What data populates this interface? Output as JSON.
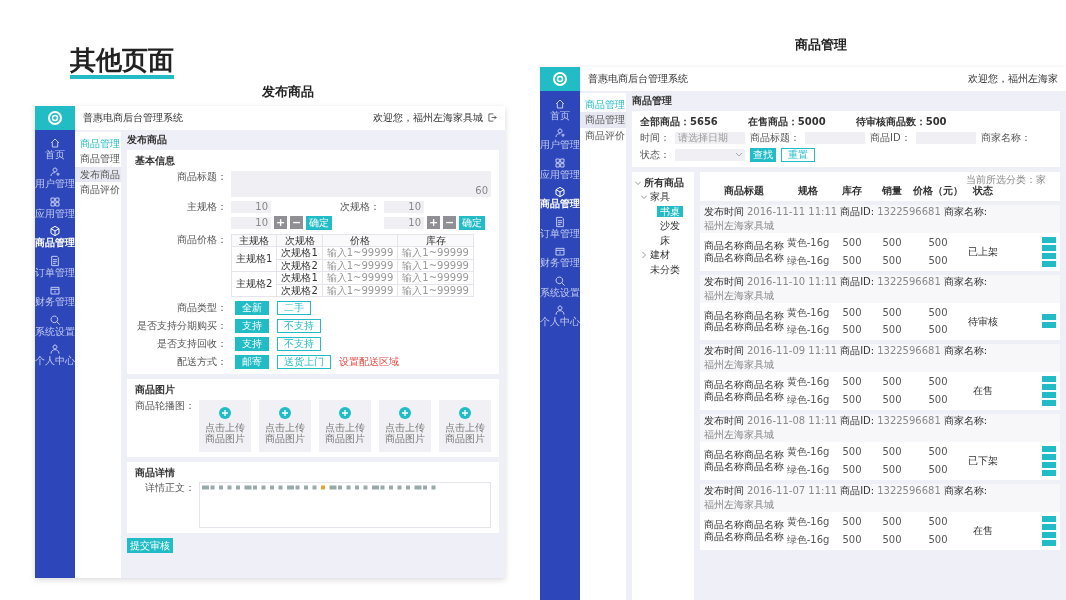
{
  "slide": {
    "title": "其他页面"
  },
  "publish": {
    "caption": "发布商品",
    "app_name": "普惠电商后台管理系统",
    "welcome": "欢迎您，福州左海家具城",
    "nav": [
      {
        "label": "首页",
        "selected": false
      },
      {
        "label": "用户管理",
        "selected": false
      },
      {
        "label": "应用管理",
        "selected": false
      },
      {
        "label": "商品管理",
        "selected": true
      },
      {
        "label": "订单管理",
        "selected": false
      },
      {
        "label": "财务管理",
        "selected": false
      },
      {
        "label": "系统设置",
        "selected": false
      },
      {
        "label": "个人中心",
        "selected": false
      }
    ],
    "subnav": {
      "title": "商品管理",
      "items": [
        {
          "label": "商品管理",
          "selected": false
        },
        {
          "label": "发布商品",
          "selected": true
        },
        {
          "label": "商品评价",
          "selected": false
        }
      ]
    },
    "page_title": "发布商品",
    "basic": {
      "heading": "基本信息",
      "title_label": "商品标题：",
      "title_counter": "60",
      "main_spec": {
        "label": "主规格：",
        "counter": "10",
        "counter2": "10",
        "plus": "+",
        "minus": "−",
        "confirm": "确定"
      },
      "sub_spec": {
        "label": "次规格：",
        "counter": "10",
        "counter2": "10",
        "plus": "+",
        "minus": "−",
        "confirm": "确定"
      },
      "price_label": "商品价格：",
      "price_columns": [
        "主规格",
        "次规格",
        "价格",
        "库存"
      ],
      "price_groups": [
        {
          "main": "主规格1",
          "subs": [
            {
              "name": "次规格1",
              "price": "输入1~99999",
              "stock": "输入1~99999"
            },
            {
              "name": "次规格2",
              "price": "输入1~99999",
              "stock": "输入1~99999"
            }
          ]
        },
        {
          "main": "主规格2",
          "subs": [
            {
              "name": "次规格1",
              "price": "输入1~99999",
              "stock": "输入1~99999"
            },
            {
              "name": "次规格2",
              "price": "输入1~99999",
              "stock": "输入1~99999"
            }
          ]
        }
      ],
      "options": [
        {
          "label": "商品类型：",
          "choices": [
            {
              "label": "全新",
              "selected": true
            },
            {
              "label": "二手",
              "selected": false
            }
          ]
        },
        {
          "label": "是否支持分期购买：",
          "choices": [
            {
              "label": "支持",
              "selected": true
            },
            {
              "label": "不支持",
              "selected": false
            }
          ]
        },
        {
          "label": "是否支持回收：",
          "choices": [
            {
              "label": "支持",
              "selected": true
            },
            {
              "label": "不支持",
              "selected": false
            }
          ]
        },
        {
          "label": "配送方式：",
          "choices": [
            {
              "label": "邮寄",
              "selected": true
            },
            {
              "label": "送货上门",
              "selected": false
            }
          ],
          "link": "设置配送区域"
        }
      ]
    },
    "pictures": {
      "heading": "商品图片",
      "label": "商品轮播图：",
      "tiles": [
        "点击上传商品图片",
        "点击上传商品图片",
        "点击上传商品图片",
        "点击上传商品图片",
        "点击上传商品图片"
      ]
    },
    "details": {
      "heading": "商品详情",
      "label": "详情正文："
    },
    "submit": "提交审核"
  },
  "manage": {
    "caption": "商品管理",
    "app_name": "普惠电商后台管理系统",
    "welcome": "欢迎您，福州左海家",
    "nav": [
      {
        "label": "首页",
        "selected": false
      },
      {
        "label": "用户管理",
        "selected": false
      },
      {
        "label": "应用管理",
        "selected": false
      },
      {
        "label": "商品管理",
        "selected": true
      },
      {
        "label": "订单管理",
        "selected": false
      },
      {
        "label": "财务管理",
        "selected": false
      },
      {
        "label": "系统设置",
        "selected": false
      },
      {
        "label": "个人中心",
        "selected": false
      }
    ],
    "subnav": {
      "title": "商品管理",
      "items": [
        {
          "label": "商品管理",
          "selected": true
        },
        {
          "label": "商品评价",
          "selected": false
        }
      ]
    },
    "page_title": "商品管理",
    "stats": [
      "全部商品：5656",
      "在售商品：5000",
      "待审核商品数：500"
    ],
    "filters": {
      "time_label": "时间：",
      "time_placeholder": "请选择日期",
      "title_label": "商品标题：",
      "id_label": "商品ID：",
      "shop_label": "商家名称：",
      "status_label": "状态：",
      "search": "查找",
      "reset": "重置"
    },
    "tree": [
      {
        "label": "所有商品",
        "expanded": true,
        "children": [
          {
            "label": "家具",
            "expanded": true,
            "children": [
              {
                "label": "书桌",
                "selected": true
              },
              {
                "label": "沙发",
                "selected": false
              },
              {
                "label": "床",
                "selected": false
              }
            ]
          },
          {
            "label": "建材",
            "expanded": false
          },
          {
            "label": "未分类"
          }
        ]
      }
    ],
    "current_category": "当前所选分类：家",
    "columns": [
      "商品标题",
      "规格",
      "库存",
      "销量",
      "价格（元）",
      "状态"
    ],
    "rows": [
      {
        "time_label": "发布时间",
        "time": "2016-11-11 11:11",
        "id_label": "商品ID:",
        "id": "1322596681",
        "shop_label": "商家名称:",
        "shop": "福州左海家具城",
        "name": "商品名称商品名称商品名称商品名称",
        "specs": [
          {
            "spec": "黄色-16g",
            "stock": "500",
            "sales": "500",
            "price": "500"
          },
          {
            "spec": "绿色-16g",
            "stock": "500",
            "sales": "500",
            "price": "500"
          }
        ],
        "status": "已上架",
        "actions": [
          {
            "kind": "button"
          },
          {
            "kind": "button"
          },
          {
            "kind": "button"
          },
          {
            "kind": "button"
          }
        ]
      },
      {
        "time_label": "发布时间",
        "time": "2016-11-10 11:11",
        "id_label": "商品ID:",
        "id": "1322596681",
        "shop_label": "商家名称:",
        "shop": "福州左海家具城",
        "name": "商品名称商品名称商品名称商品名称",
        "specs": [
          {
            "spec": "黄色-16g",
            "stock": "500",
            "sales": "500",
            "price": "500"
          },
          {
            "spec": "绿色-16g",
            "stock": "500",
            "sales": "500",
            "price": "500"
          }
        ],
        "status": "待审核",
        "actions": [
          {
            "kind": "button"
          },
          {
            "kind": "button"
          }
        ]
      },
      {
        "time_label": "发布时间",
        "time": "2016-11-09 11:11",
        "id_label": "商品ID:",
        "id": "1322596681",
        "shop_label": "商家名称:",
        "shop": "福州左海家具城",
        "name": "商品名称商品名称商品名称商品名称",
        "specs": [
          {
            "spec": "黄色-16g",
            "stock": "500",
            "sales": "500",
            "price": "500"
          },
          {
            "spec": "绿色-16g",
            "stock": "500",
            "sales": "500",
            "price": "500"
          }
        ],
        "status": "在售",
        "actions": [
          {
            "kind": "button"
          },
          {
            "kind": "button"
          },
          {
            "kind": "button"
          },
          {
            "kind": "button"
          }
        ]
      },
      {
        "time_label": "发布时间",
        "time": "2016-11-08 11:11",
        "id_label": "商品ID:",
        "id": "1322596681",
        "shop_label": "商家名称:",
        "shop": "福州左海家具城",
        "name": "商品名称商品名称商品名称商品名称",
        "specs": [
          {
            "spec": "黄色-16g",
            "stock": "500",
            "sales": "500",
            "price": "500"
          },
          {
            "spec": "绿色-16g",
            "stock": "500",
            "sales": "500",
            "price": "500"
          }
        ],
        "status": "已下架",
        "actions": [
          {
            "kind": "button"
          },
          {
            "kind": "button"
          },
          {
            "kind": "button"
          },
          {
            "kind": "button"
          }
        ]
      },
      {
        "time_label": "发布时间",
        "time": "2016-11-07 11:11",
        "id_label": "商品ID:",
        "id": "1322596681",
        "shop_label": "商家名称:",
        "shop": "福州左海家具城",
        "name": "商品名称商品名称商品名称商品名称",
        "specs": [
          {
            "spec": "黄色-16g",
            "stock": "500",
            "sales": "500",
            "price": "500"
          },
          {
            "spec": "绿色-16g",
            "stock": "500",
            "sales": "500",
            "price": "500"
          }
        ],
        "status": "在售",
        "actions": [
          {
            "kind": "button"
          },
          {
            "kind": "button"
          },
          {
            "kind": "button"
          },
          {
            "kind": "button"
          }
        ]
      }
    ]
  }
}
